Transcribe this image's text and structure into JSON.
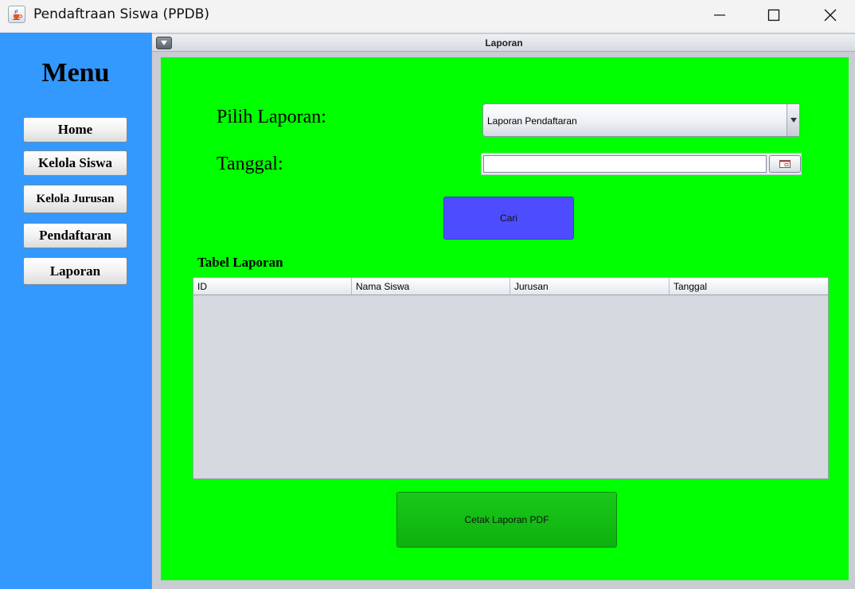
{
  "window": {
    "title": "Pendaftraan Siswa (PPDB)"
  },
  "sidebar": {
    "title": "Menu",
    "items": [
      {
        "label": "Home"
      },
      {
        "label": "Kelola Siswa"
      },
      {
        "label": "Kelola Jurusan"
      },
      {
        "label": "Pendaftaran"
      },
      {
        "label": "Laporan"
      }
    ]
  },
  "frame": {
    "title": "Laporan"
  },
  "form": {
    "report_label": "Pilih Laporan:",
    "report_selected": "Laporan Pendaftaran",
    "date_label": "Tanggal:",
    "date_value": "",
    "search_button": "Cari"
  },
  "table": {
    "title": "Tabel Laporan",
    "columns": [
      "ID",
      "Nama Siswa",
      "Jurusan",
      "Tanggal"
    ],
    "rows": []
  },
  "print_button": "Cetak Laporan PDF",
  "colors": {
    "sidebar": "#3399ff",
    "content": "#00ff00",
    "search_button": "#4d4dff",
    "print_button": "#13bd13"
  },
  "icons": {
    "app": "java-cup-icon",
    "minimize": "minimize-icon",
    "maximize": "maximize-icon",
    "close": "close-icon",
    "frame_menu": "chevron-down-icon",
    "combo": "dropdown-arrow-icon",
    "date": "calendar-icon"
  }
}
